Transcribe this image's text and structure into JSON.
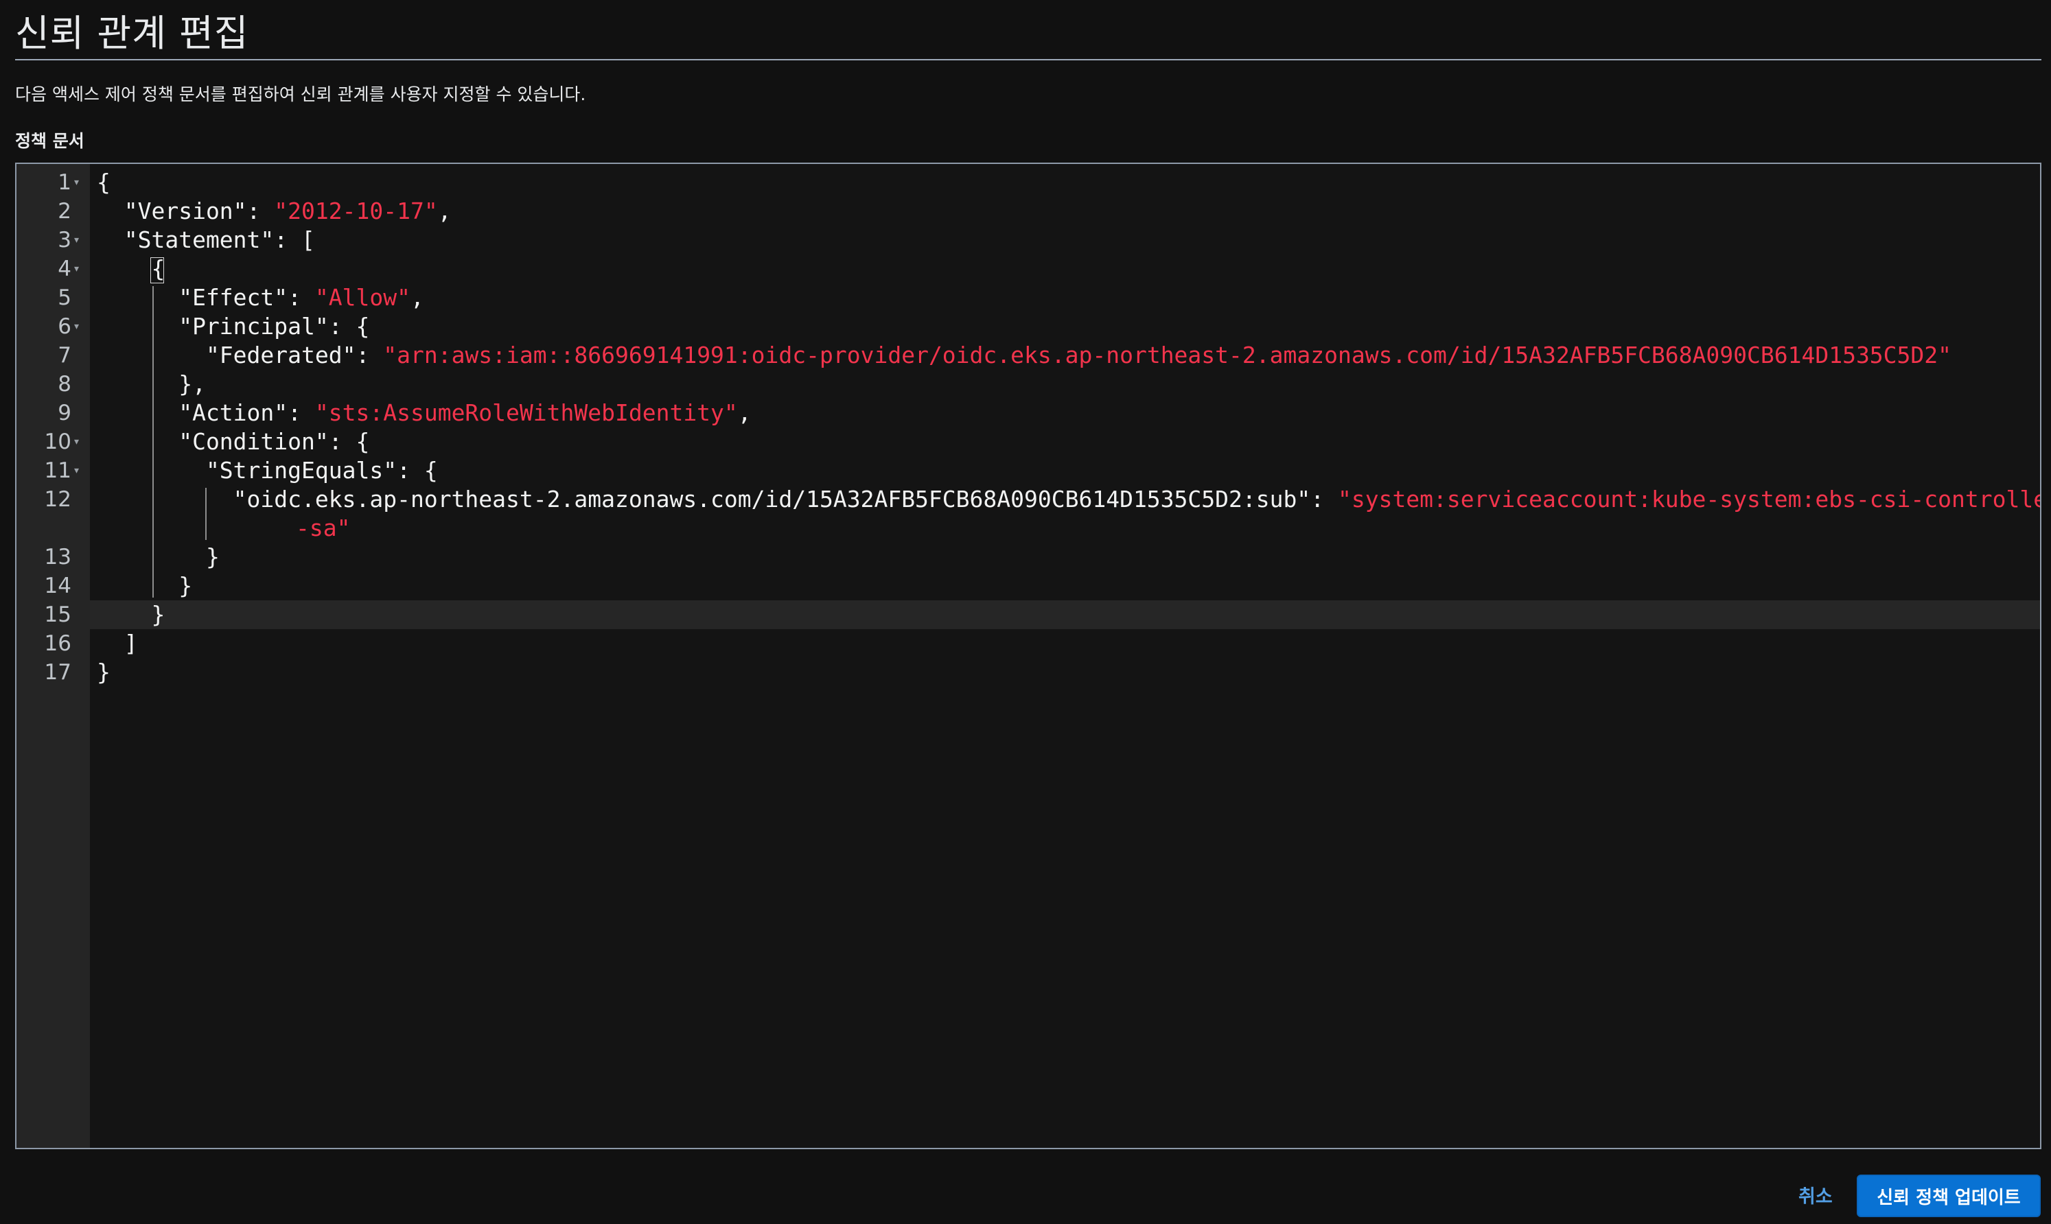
{
  "header": {
    "title": "신뢰 관계 편집",
    "description": "다음 액세스 제어 정책 문서를 편집하여 신뢰 관계를 사용자 지정할 수 있습니다."
  },
  "editor": {
    "label": "정책 문서",
    "active_line": 15,
    "lines": [
      {
        "num": "1",
        "fold": true,
        "parts": [
          {
            "t": "{"
          }
        ]
      },
      {
        "num": "2",
        "fold": false,
        "parts": [
          {
            "t": "  \"Version\": "
          },
          {
            "t": "\"2012-10-17\"",
            "s": true
          },
          {
            "t": ","
          }
        ]
      },
      {
        "num": "3",
        "fold": true,
        "parts": [
          {
            "t": "  \"Statement\": ["
          }
        ]
      },
      {
        "num": "4",
        "fold": true,
        "parts": [
          {
            "t": "    {"
          }
        ]
      },
      {
        "num": "5",
        "fold": false,
        "parts": [
          {
            "t": "      \"Effect\": "
          },
          {
            "t": "\"Allow\"",
            "s": true
          },
          {
            "t": ","
          }
        ]
      },
      {
        "num": "6",
        "fold": true,
        "parts": [
          {
            "t": "      \"Principal\": {"
          }
        ]
      },
      {
        "num": "7",
        "fold": false,
        "parts": [
          {
            "t": "        \"Federated\": "
          },
          {
            "t": "\"arn:aws:iam::866969141991:oidc-provider/oidc.eks.ap-northeast-2.amazonaws.com/id/15A32AFB5FCB68A090CB614D1535C5D2\"",
            "s": true
          }
        ]
      },
      {
        "num": "8",
        "fold": false,
        "parts": [
          {
            "t": "      },"
          }
        ]
      },
      {
        "num": "9",
        "fold": false,
        "parts": [
          {
            "t": "      \"Action\": "
          },
          {
            "t": "\"sts:AssumeRoleWithWebIdentity\"",
            "s": true
          },
          {
            "t": ","
          }
        ]
      },
      {
        "num": "10",
        "fold": true,
        "parts": [
          {
            "t": "      \"Condition\": {"
          }
        ]
      },
      {
        "num": "11",
        "fold": true,
        "parts": [
          {
            "t": "        \"StringEquals\": {"
          }
        ]
      },
      {
        "num": "12",
        "fold": false,
        "parts": [
          {
            "t": "          \"oidc.eks.ap-northeast-2.amazonaws.com/id/15A32AFB5FCB68A090CB614D1535C5D2:sub\": "
          },
          {
            "t": "\"system:serviceaccount:kube-system:ebs-csi-controller",
            "s": true
          }
        ]
      },
      {
        "num": "",
        "fold": false,
        "cont": true,
        "parts": [
          {
            "t": "-sa\"",
            "s": true
          }
        ]
      },
      {
        "num": "13",
        "fold": false,
        "parts": [
          {
            "t": "        }"
          }
        ]
      },
      {
        "num": "14",
        "fold": false,
        "parts": [
          {
            "t": "      }"
          }
        ]
      },
      {
        "num": "15",
        "fold": false,
        "parts": [
          {
            "t": "    }"
          }
        ]
      },
      {
        "num": "16",
        "fold": false,
        "parts": [
          {
            "t": "  ]"
          }
        ]
      },
      {
        "num": "17",
        "fold": false,
        "parts": [
          {
            "t": "}"
          }
        ]
      }
    ]
  },
  "footer": {
    "cancel_label": "취소",
    "submit_label": "신뢰 정책 업데이트"
  },
  "colors": {
    "background": "#111111",
    "string": "#f2344c",
    "primary_button": "#0972d3",
    "link": "#539fe5"
  }
}
